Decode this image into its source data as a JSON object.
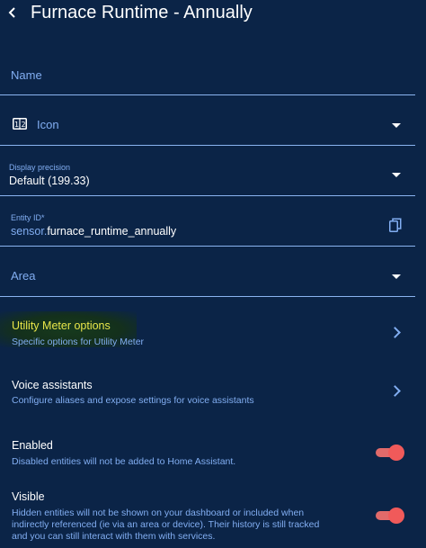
{
  "header": {
    "title": "Furnace Runtime - Annually"
  },
  "name_field": {
    "label": "Name"
  },
  "icon_field": {
    "label": "Icon"
  },
  "precision_field": {
    "label": "Display precision",
    "value": "Default (199.33)"
  },
  "entity_field": {
    "label": "Entity ID*",
    "prefix": "sensor.",
    "value": "furnace_runtime_annually"
  },
  "area_field": {
    "label": "Area"
  },
  "utility_meter": {
    "title": "Utility Meter options",
    "subtitle": "Specific options for Utility Meter"
  },
  "voice": {
    "title": "Voice assistants",
    "subtitle": "Configure aliases and expose settings for voice assistants"
  },
  "enabled": {
    "title": "Enabled",
    "subtitle": "Disabled entities will not be added to Home Assistant.",
    "on": true
  },
  "visible": {
    "title": "Visible",
    "line1": "Hidden entities will not be shown on your dashboard or included when",
    "line2": "indirectly referenced (ie via an area or device). Their history is still tracked",
    "line3": "and you can still interact with them with services.",
    "on": true
  },
  "colors": {
    "background": "#0b2447",
    "accent": "#82aef2",
    "toggle": "#f05a5a",
    "highlight_text": "#e8e64a"
  },
  "icons": [
    "back-arrow-icon",
    "numeric-icon",
    "dropdown-arrow-icon",
    "copy-icon",
    "chevron-right-icon"
  ]
}
